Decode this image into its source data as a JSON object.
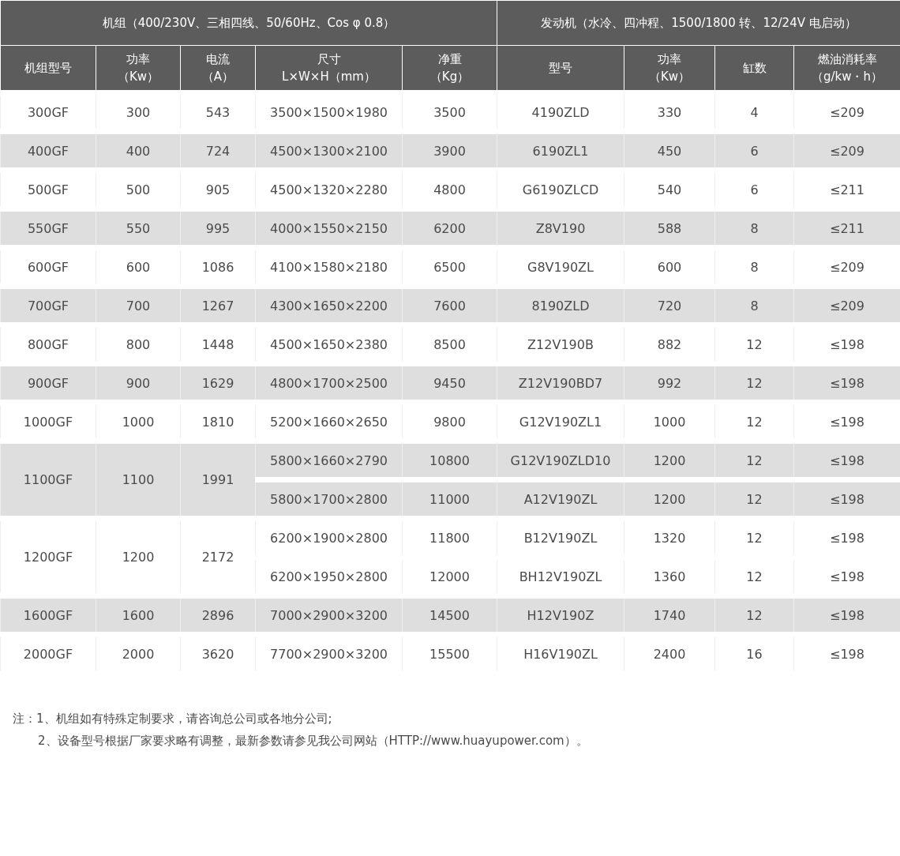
{
  "group_headers": [
    {
      "label": "机组（400/230V、三相四线、50/60Hz、Cos φ 0.8）"
    },
    {
      "label": "发动机（水冷、四冲程、1500/1800 转、12/24V 电启动）"
    }
  ],
  "columns": [
    {
      "line1": "机组型号"
    },
    {
      "line1": "功率",
      "line2": "（Kw）"
    },
    {
      "line1": "电流",
      "line2": "（A）"
    },
    {
      "line1": "尺寸",
      "line2": "L×W×H（mm）"
    },
    {
      "line1": "净重",
      "line2": "（Kg）"
    },
    {
      "line1": "型号"
    },
    {
      "line1": "功率",
      "line2": "（Kw）"
    },
    {
      "line1": "缸数"
    },
    {
      "line1": "燃油消耗率",
      "line2": "（g/kw・h）"
    }
  ],
  "rows": [
    {
      "model": "300GF",
      "power": "300",
      "current": "543",
      "variants": [
        {
          "size": "3500×1500×1980",
          "weight": "3500",
          "engine": "4190ZLD",
          "engine_power": "330",
          "cylinders": "4",
          "fuel": "≤209"
        }
      ]
    },
    {
      "model": "400GF",
      "power": "400",
      "current": "724",
      "variants": [
        {
          "size": "4500×1300×2100",
          "weight": "3900",
          "engine": "6190ZL1",
          "engine_power": "450",
          "cylinders": "6",
          "fuel": "≤209"
        }
      ]
    },
    {
      "model": "500GF",
      "power": "500",
      "current": "905",
      "variants": [
        {
          "size": "4500×1320×2280",
          "weight": "4800",
          "engine": "G6190ZLCD",
          "engine_power": "540",
          "cylinders": "6",
          "fuel": "≤211"
        }
      ]
    },
    {
      "model": "550GF",
      "power": "550",
      "current": "995",
      "variants": [
        {
          "size": "4000×1550×2150",
          "weight": "6200",
          "engine": "Z8V190",
          "engine_power": "588",
          "cylinders": "8",
          "fuel": "≤211"
        }
      ]
    },
    {
      "model": "600GF",
      "power": "600",
      "current": "1086",
      "variants": [
        {
          "size": "4100×1580×2180",
          "weight": "6500",
          "engine": "G8V190ZL",
          "engine_power": "600",
          "cylinders": "8",
          "fuel": "≤209"
        }
      ]
    },
    {
      "model": "700GF",
      "power": "700",
      "current": "1267",
      "variants": [
        {
          "size": "4300×1650×2200",
          "weight": "7600",
          "engine": "8190ZLD",
          "engine_power": "720",
          "cylinders": "8",
          "fuel": "≤209"
        }
      ]
    },
    {
      "model": "800GF",
      "power": "800",
      "current": "1448",
      "variants": [
        {
          "size": "4500×1650×2380",
          "weight": "8500",
          "engine": "Z12V190B",
          "engine_power": "882",
          "cylinders": "12",
          "fuel": "≤198"
        }
      ]
    },
    {
      "model": "900GF",
      "power": "900",
      "current": "1629",
      "variants": [
        {
          "size": "4800×1700×2500",
          "weight": "9450",
          "engine": "Z12V190BD7",
          "engine_power": "992",
          "cylinders": "12",
          "fuel": "≤198"
        }
      ]
    },
    {
      "model": "1000GF",
      "power": "1000",
      "current": "1810",
      "variants": [
        {
          "size": "5200×1660×2650",
          "weight": "9800",
          "engine": "G12V190ZL1",
          "engine_power": "1000",
          "cylinders": "12",
          "fuel": "≤198"
        }
      ]
    },
    {
      "model": "1100GF",
      "power": "1100",
      "current": "1991",
      "variants": [
        {
          "size": "5800×1660×2790",
          "weight": "10800",
          "engine": "G12V190ZLD10",
          "engine_power": "1200",
          "cylinders": "12",
          "fuel": "≤198"
        },
        {
          "size": "5800×1700×2800",
          "weight": "11000",
          "engine": "A12V190ZL",
          "engine_power": "1200",
          "cylinders": "12",
          "fuel": "≤198"
        }
      ]
    },
    {
      "model": "1200GF",
      "power": "1200",
      "current": "2172",
      "variants": [
        {
          "size": "6200×1900×2800",
          "weight": "11800",
          "engine": "B12V190ZL",
          "engine_power": "1320",
          "cylinders": "12",
          "fuel": "≤198"
        },
        {
          "size": "6200×1950×2800",
          "weight": "12000",
          "engine": "BH12V190ZL",
          "engine_power": "1360",
          "cylinders": "12",
          "fuel": "≤198"
        }
      ]
    },
    {
      "model": "1600GF",
      "power": "1600",
      "current": "2896",
      "variants": [
        {
          "size": "7000×2900×3200",
          "weight": "14500",
          "engine": "H12V190Z",
          "engine_power": "1740",
          "cylinders": "12",
          "fuel": "≤198"
        }
      ]
    },
    {
      "model": "2000GF",
      "power": "2000",
      "current": "3620",
      "variants": [
        {
          "size": "7700×2900×3200",
          "weight": "15500",
          "engine": "H16V190ZL",
          "engine_power": "2400",
          "cylinders": "16",
          "fuel": "≤198"
        }
      ]
    }
  ],
  "notes": [
    "注：1、机组如有特殊定制要求，请咨询总公司或各地分公司;",
    "2、设备型号根据厂家要求略有调整，最新参数请参见我公司网站（HTTP://www.huayupower.com）。"
  ]
}
